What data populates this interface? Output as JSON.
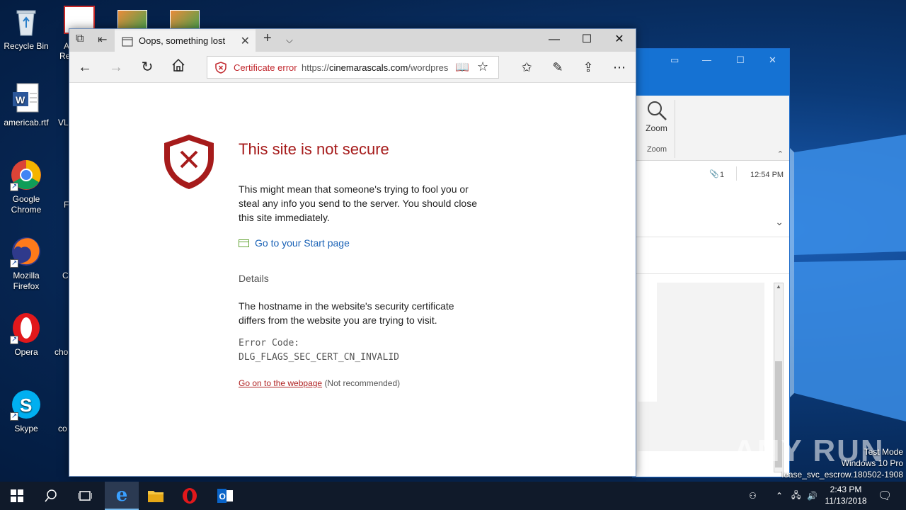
{
  "desktop": {
    "icons": [
      {
        "label": "Recycle Bin"
      },
      {
        "label": "americab.rtf"
      },
      {
        "label": "Google Chrome"
      },
      {
        "label": "Mozilla Firefox"
      },
      {
        "label": "Opera"
      },
      {
        "label": "Skype"
      }
    ],
    "partial_labels": [
      "A",
      "Re",
      "VL",
      "I",
      "F",
      "C",
      "cho",
      "co"
    ]
  },
  "outlook_window": {
    "zoom_label": "Zoom",
    "zoom_group_label": "Zoom",
    "attachment_count": "1",
    "time": "12:54 PM"
  },
  "edge": {
    "tab_title": "Oops, something lost",
    "address": {
      "cert_label": "Certificate error",
      "url_prefix": "https://",
      "url_host": "cinemarascals.com",
      "url_path": "/wordpres"
    },
    "page": {
      "title": "This site is not secure",
      "message": "This might mean that someone's trying to fool you or steal any info you send to the server. You should close this site immediately.",
      "start_link": "Go to your Start page",
      "details_heading": "Details",
      "details_text": "The hostname in the website's security certificate differs from the website you are trying to visit.",
      "error_code_label": "Error Code:",
      "error_code": "DLG_FLAGS_SEC_CERT_CN_INVALID",
      "goon_link": "Go on to the webpage",
      "goon_note": "(Not recommended)"
    }
  },
  "taskbar": {
    "time": "2:43 PM",
    "date": "11/13/2018"
  },
  "watermark": {
    "text": "ANY RUN",
    "test_mode": "Test Mode",
    "edition": "Windows 10 Pro",
    "build": "lease_svc_escrow.180502-1908"
  },
  "colors": {
    "error_red": "#a61b1b",
    "link_blue": "#1a62b6",
    "outlook_blue": "#1572d3"
  }
}
